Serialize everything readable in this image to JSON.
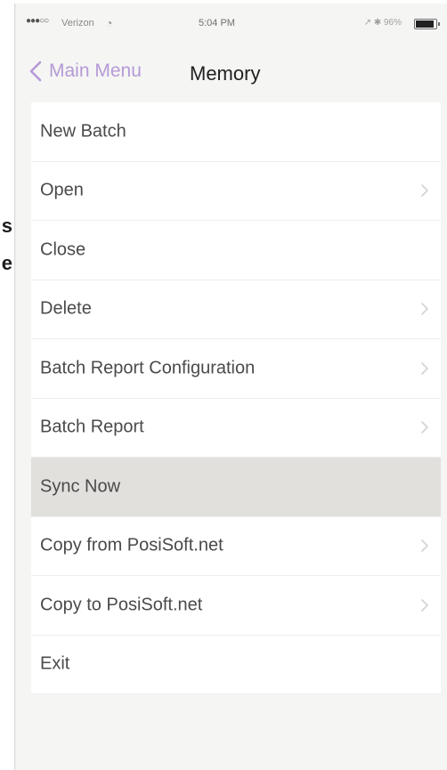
{
  "outside_fragments": [
    "s",
    "e"
  ],
  "status_bar": {
    "signal": "●●●○○",
    "carrier": "Verizon",
    "time": "5:04 PM",
    "right_indicators": "↗ ✱ 96%",
    "battery_level": 0.96
  },
  "nav": {
    "back_label": "Main Menu",
    "title": "Memory"
  },
  "menu": {
    "items": [
      {
        "label": "New Batch",
        "chevron": false,
        "selected": false
      },
      {
        "label": "Open",
        "chevron": true,
        "selected": false
      },
      {
        "label": "Close",
        "chevron": false,
        "selected": false
      },
      {
        "label": "Delete",
        "chevron": true,
        "selected": false
      },
      {
        "label": "Batch Report Configuration",
        "chevron": true,
        "selected": false
      },
      {
        "label": "Batch Report",
        "chevron": true,
        "selected": false
      },
      {
        "label": "Sync Now",
        "chevron": false,
        "selected": true
      },
      {
        "label": "Copy from PosiSoft.net",
        "chevron": true,
        "selected": false
      },
      {
        "label": "Copy to PosiSoft.net",
        "chevron": true,
        "selected": false
      },
      {
        "label": "Exit",
        "chevron": false,
        "selected": false
      }
    ]
  },
  "colors": {
    "accent": "#b59ad6",
    "selected_row": "#e2e0dd",
    "chevron": "#d3d3d3"
  }
}
